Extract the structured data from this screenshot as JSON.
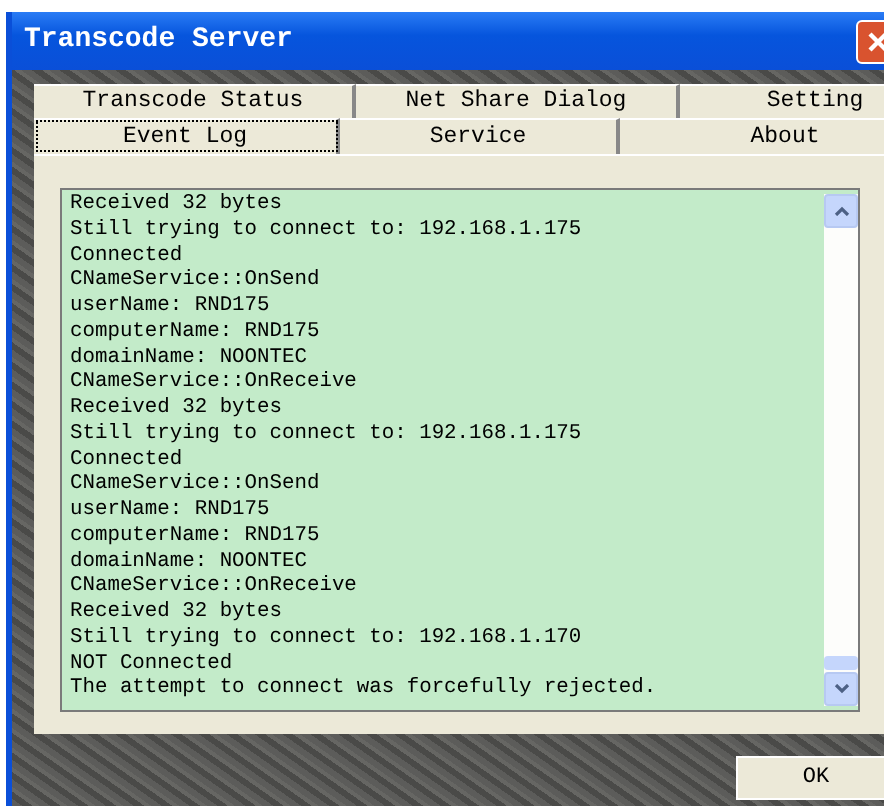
{
  "window": {
    "title": "Transcode Server"
  },
  "tab_rows": [
    [
      {
        "label": "Transcode Status",
        "selected": false
      },
      {
        "label": "Net Share Dialog",
        "selected": false
      },
      {
        "label": "Setting",
        "selected": false
      }
    ],
    [
      {
        "label": "Event Log",
        "selected": true
      },
      {
        "label": "Service",
        "selected": false
      },
      {
        "label": "About",
        "selected": false
      }
    ]
  ],
  "log": {
    "lines": [
      "Received 32 bytes",
      "Still trying to connect to: 192.168.1.175",
      "Connected",
      "CNameService::OnSend",
      "userName: RND175",
      "computerName: RND175",
      "domainName: NOONTEC",
      "CNameService::OnReceive",
      "Received 32 bytes",
      "Still trying to connect to: 192.168.1.175",
      "Connected",
      "CNameService::OnSend",
      "userName: RND175",
      "computerName: RND175",
      "domainName: NOONTEC",
      "CNameService::OnReceive",
      "Received 32 bytes",
      "Still trying to connect to: 192.168.1.170",
      "NOT Connected",
      "The attempt to connect was forcefully rejected."
    ]
  },
  "buttons": [
    {
      "label": "OK"
    }
  ]
}
